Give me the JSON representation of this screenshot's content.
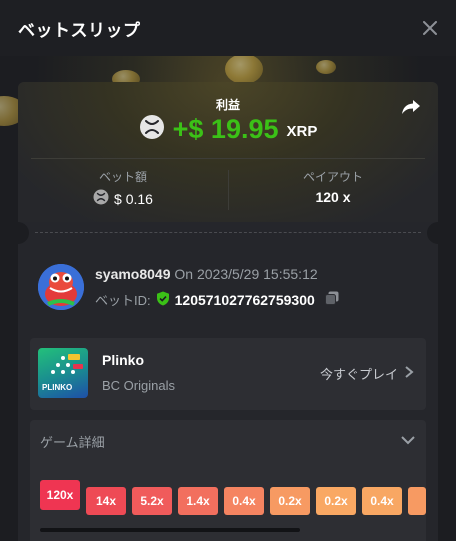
{
  "header": {
    "title": "ベットスリップ"
  },
  "profit": {
    "label": "利益",
    "value": "+$ 19.95",
    "currency": "XRP"
  },
  "bet_amount": {
    "label": "ベット額",
    "value": "$ 0.16"
  },
  "payout": {
    "label": "ペイアウト",
    "value": "120 x"
  },
  "user": {
    "name": "syamo8049",
    "on_text": "On 2023/5/29 15:55:12",
    "bet_id_label": "ベットID:",
    "bet_id": "120571027762759300"
  },
  "game": {
    "name": "Plinko",
    "provider": "BC Originals",
    "play_now": "今すぐプレイ",
    "thumb_text": "PLINKO"
  },
  "details": {
    "title": "ゲーム詳細"
  },
  "multipliers": [
    "120x",
    "14x",
    "5.2x",
    "1.4x",
    "0.4x",
    "0.2x",
    "0.2x",
    "0.4x"
  ],
  "colors": {
    "profit_green": "#3bc117",
    "accent_red": "#ef3552",
    "shield_green": "#3bc117"
  }
}
